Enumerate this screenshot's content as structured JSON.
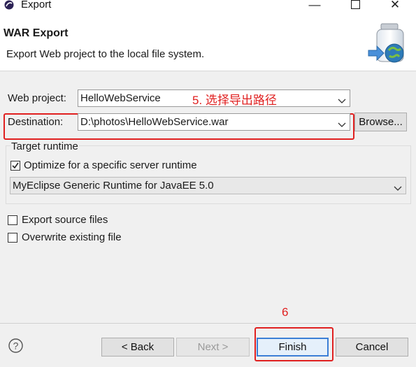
{
  "window": {
    "title": "Export"
  },
  "banner": {
    "heading": "WAR Export",
    "description": "Export Web project to the local file system."
  },
  "form": {
    "web_project_label": "Web project:",
    "web_project_value": "HelloWebService",
    "destination_label": "Destination:",
    "destination_value": "D:\\photos\\HelloWebService.war",
    "browse_label": "Browse..."
  },
  "target_runtime": {
    "group_title": "Target runtime",
    "optimize_label": "Optimize for a specific server runtime",
    "optimize_checked": true,
    "runtime_value": "MyEclipse Generic Runtime for JavaEE 5.0"
  },
  "options": {
    "export_source_label": "Export source files",
    "export_source_checked": false,
    "overwrite_label": "Overwrite existing file",
    "overwrite_checked": false
  },
  "buttons": {
    "back": "< Back",
    "next": "Next >",
    "finish": "Finish",
    "cancel": "Cancel"
  },
  "annotations": {
    "step5": "5. 选择导出路径",
    "step6": "6",
    "color": "#e02020"
  },
  "icons": [
    "eclipse-app-icon",
    "minimize-icon",
    "maximize-icon",
    "close-icon",
    "war-export-wizard-icon",
    "chevron-down-icon",
    "checkmark-icon",
    "help-icon"
  ]
}
